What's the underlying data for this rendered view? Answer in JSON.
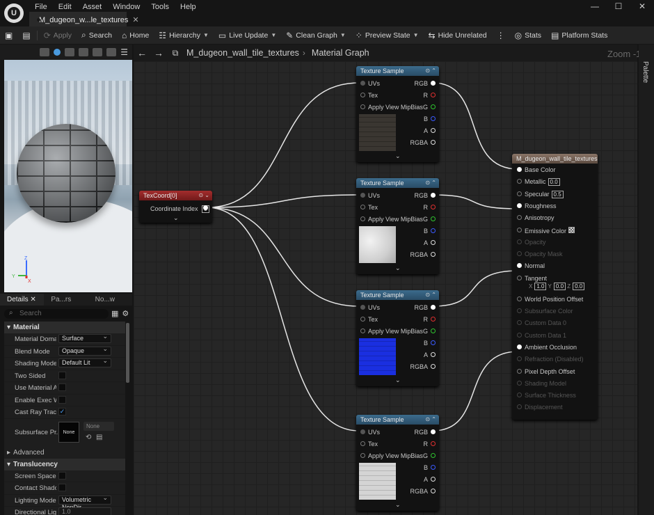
{
  "menu": [
    "File",
    "Edit",
    "Asset",
    "Window",
    "Tools",
    "Help"
  ],
  "document_tab": "M_dugeon_w...le_textures",
  "window_controls": [
    "—",
    "☐",
    "✕"
  ],
  "toolbar": {
    "apply": "Apply",
    "search": "Search",
    "home": "Home",
    "hierarchy": "Hierarchy",
    "live_update": "Live Update",
    "clean_graph": "Clean Graph",
    "preview_state": "Preview State",
    "hide_unrelated": "Hide Unrelated",
    "stats": "Stats",
    "platform_stats": "Platform Stats"
  },
  "breadcrumb": {
    "material": "M_dugeon_wall_tile_textures",
    "graph": "Material Graph"
  },
  "zoom": "Zoom -1",
  "palette": "Palette",
  "details_tabs": [
    "Details",
    "Pa...rs",
    "No...w"
  ],
  "details_search_placeholder": "Search",
  "sections": {
    "material": "Material",
    "advanced": "Advanced",
    "translucency": "Translucency"
  },
  "material_rows": [
    {
      "label": "Material Domain",
      "value": "Surface"
    },
    {
      "label": "Blend Mode",
      "value": "Opaque"
    },
    {
      "label": "Shading Model",
      "value": "Default Lit"
    },
    {
      "label": "Two Sided",
      "checked": false
    },
    {
      "label": "Use Material A...",
      "checked": false
    },
    {
      "label": "Enable Exec Wire",
      "checked": false
    },
    {
      "label": "Cast Ray Trac...",
      "checked": true
    }
  ],
  "subsurface": {
    "label": "Subsurface Pr...",
    "box": "None",
    "dropdown": "None"
  },
  "translucency_rows": [
    {
      "label": "Screen Space..."
    },
    {
      "label": "Contact Shado..."
    },
    {
      "label": "Lighting Mode",
      "value": "Volumetric NonDir"
    },
    {
      "label": "Directional Lig...",
      "value": "1.0"
    }
  ],
  "texcoord": {
    "title": "TexCoord[0]",
    "pin": "Coordinate Index",
    "value": "0"
  },
  "texture_sample": {
    "title": "Texture Sample",
    "inputs": [
      "UVs",
      "Tex",
      "Apply View MipBias"
    ],
    "outputs": [
      "RGB",
      "R",
      "G",
      "B",
      "A",
      "RGBA"
    ]
  },
  "texture_tints": [
    "#3a3631",
    "#cfcfcf",
    "#1a2fe0",
    "#d4d4d4"
  ],
  "output_node": {
    "title": "M_dugeon_wall_tile_textures",
    "pins": [
      {
        "label": "Base Color",
        "active": true
      },
      {
        "label": "Metallic",
        "value": "0.0"
      },
      {
        "label": "Specular",
        "value": "0.5"
      },
      {
        "label": "Roughness",
        "active": true
      },
      {
        "label": "Anisotropy"
      },
      {
        "label": "Emissive Color"
      },
      {
        "label": "Opacity",
        "dim": true
      },
      {
        "label": "Opacity Mask",
        "dim": true
      },
      {
        "label": "Normal",
        "active": true
      },
      {
        "label": "Tangent"
      },
      {
        "label": "World Position Offset"
      },
      {
        "label": "Subsurface Color",
        "dim": true
      },
      {
        "label": "Custom Data 0",
        "dim": true
      },
      {
        "label": "Custom Data 1",
        "dim": true
      },
      {
        "label": "Ambient Occlusion",
        "active": true
      },
      {
        "label": "Refraction (Disabled)",
        "dim": true
      },
      {
        "label": "Pixel Depth Offset"
      },
      {
        "label": "Shading Model",
        "dim": true
      },
      {
        "label": "Surface Thickness",
        "dim": true
      },
      {
        "label": "Displacement",
        "dim": true
      }
    ],
    "tangent": {
      "x": "1.0",
      "y": "0.0",
      "z": "0.0"
    }
  },
  "axis_labels": {
    "z": "Z",
    "y": "Y",
    "x": "X"
  }
}
